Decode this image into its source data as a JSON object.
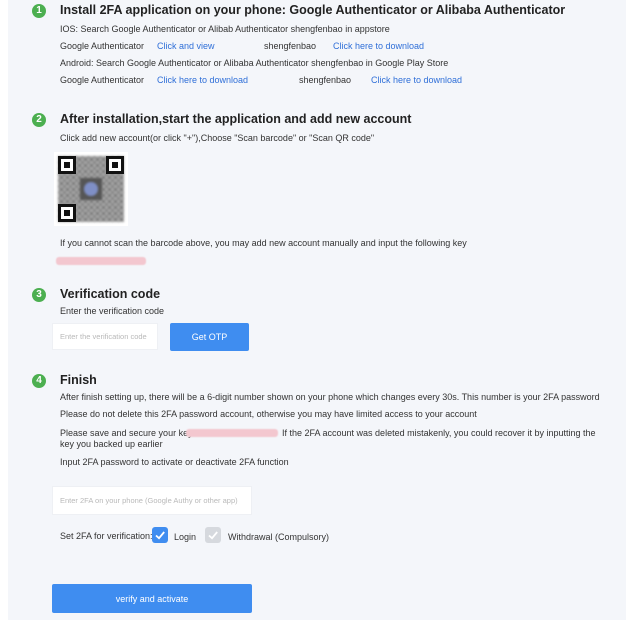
{
  "step1": {
    "number": "1",
    "title": "Install 2FA application on your phone: Google Authenticator or Alibaba Authenticator",
    "ios_text": "IOS: Search Google Authenticator or Alibab Authenticator shengfenbao in appstore",
    "row1": {
      "app": "Google Authenticator",
      "link1": "Click and view",
      "app2": "shengfenbao",
      "link2": "Click here to download"
    },
    "android_text": "Android: Search Google Authenticator or Alibaba Authenticator shengfenbao in Google Play Store",
    "row2": {
      "app": "Google Authenticator",
      "link1": "Click here to download",
      "app2": "shengfenbao",
      "link2": "Click here to download"
    }
  },
  "step2": {
    "number": "2",
    "title": "After installation,start the application and add new account",
    "instruction": "Click add new account(or click \"+\"),Choose \"Scan barcode\" or \"Scan QR code\"",
    "manual_text": "If you cannot scan the barcode above, you may add new account manually and input the following key"
  },
  "step3": {
    "number": "3",
    "title": "Verification code",
    "label": "Enter the verification code",
    "placeholder": "Enter the verification code",
    "button": "Get OTP"
  },
  "step4": {
    "number": "4",
    "title": "Finish",
    "line1": "After finish setting up, there will be a 6-digit number shown on your phone which changes every 30s. This number is your 2FA password",
    "line2": "Please do not delete this 2FA password account, otherwise you may have limited access to your account",
    "line3a": "Please save and secure your key",
    "line3b": "If the 2FA account was deleted mistakenly, you could recover it by inputting the",
    "line3c": "key you backed up earlier",
    "line4": "Input 2FA password to activate or deactivate 2FA function",
    "placeholder": "Enter 2FA on your phone (Google Authy or other app)",
    "set_label": "Set 2FA for verification:",
    "option_login": "Login",
    "option_withdrawal": "Withdrawal (Compulsory)",
    "button": "verify and activate"
  },
  "colors": {
    "badge": "#4caf50",
    "link": "#2f6fd8",
    "button": "#3f8df0",
    "panel": "#f4f6fa"
  }
}
